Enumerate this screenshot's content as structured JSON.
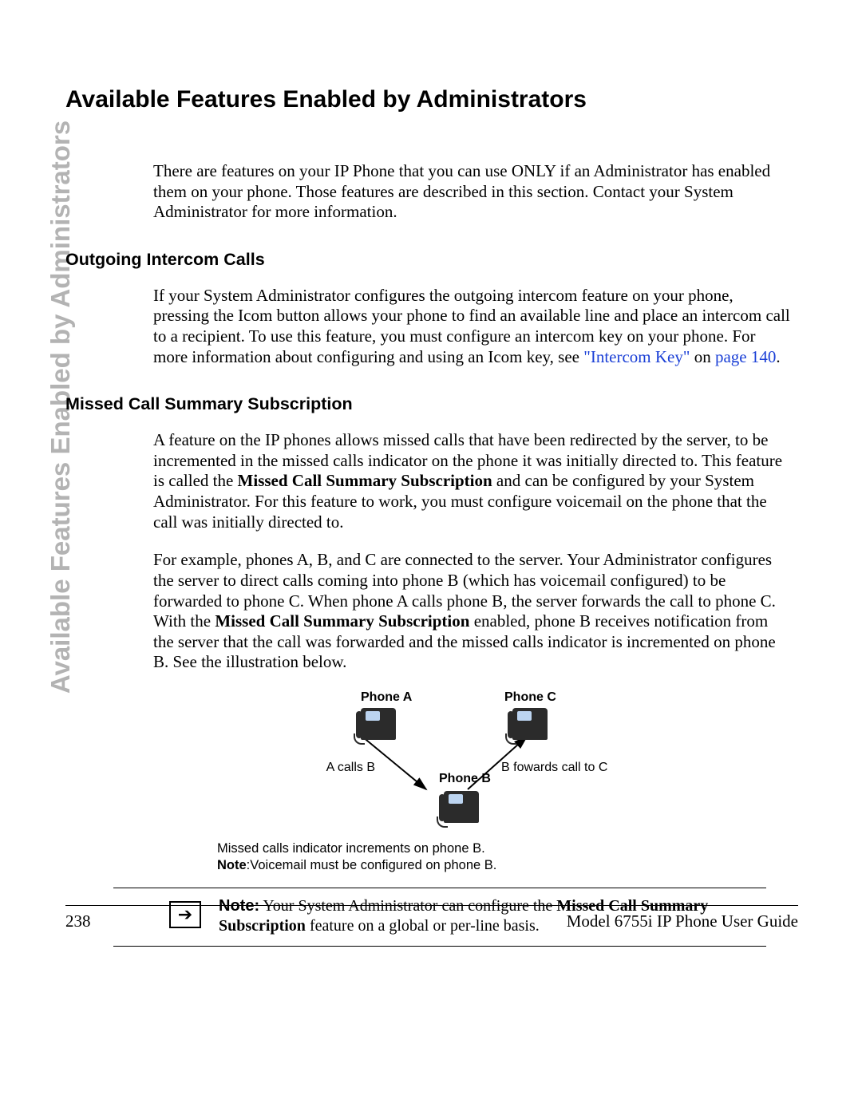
{
  "side_title": "Available Features Enabled by Administrators",
  "main_heading": "Available Features Enabled by Administrators",
  "intro": "There are features on your IP Phone that you can use ONLY if an Administrator has enabled them on your phone. Those features are described in this section. Contact your System Administrator for more information.",
  "section1": {
    "heading": "Outgoing Intercom Calls",
    "para_pre": "If your System Administrator configures the outgoing intercom feature on your phone, pressing the Icom button allows your phone to find an available line and place an intercom call to a recipient. To use this feature, you must configure an intercom key on your phone. For more information about configuring and using an Icom key, see ",
    "link": "\"Intercom Key\"",
    "on_word": " on ",
    "page_ref": "page 140",
    "period": "."
  },
  "section2": {
    "heading": "Missed Call Summary Subscription",
    "p1_a": "A feature on the IP phones allows missed calls that have been redirected by the server, to be incremented in the missed calls indicator on the phone it was initially directed to. This feature is called the ",
    "p1_bold": "Missed Call Summary Subscription",
    "p1_b": " and can be configured by your System Administrator. For this feature to work, you must configure voicemail on the phone that the call was initially directed to.",
    "p2_a": "For example, phones A, B, and C are connected to the server. Your Administrator configures the server to direct calls coming into phone B (which has voicemail configured) to be forwarded to phone C. When phone A calls phone B, the server forwards the call to phone C. With the ",
    "p2_bold": "Missed Call Summary Subscription",
    "p2_b": " enabled, phone B receives notification from the server that the call was forwarded and the missed calls indicator is incremented on phone B. See the illustration below."
  },
  "diagram": {
    "phoneA": "Phone A",
    "phoneB": "Phone B",
    "phoneC": "Phone C",
    "arrow1": "A calls B",
    "arrow2": "B fowards call to C"
  },
  "caption_line1": "Missed calls indicator increments on phone B.",
  "caption_note_label": "Note",
  "caption_line2": ":Voicemail must be configured on phone B.",
  "note": {
    "label": "Note:",
    "text_a": " Your System Administrator can configure the ",
    "bold": "Missed Call Summary Subscription",
    "text_b": " feature on a global or per-line basis."
  },
  "footer": {
    "page": "238",
    "doc": "Model 6755i IP Phone User Guide"
  }
}
